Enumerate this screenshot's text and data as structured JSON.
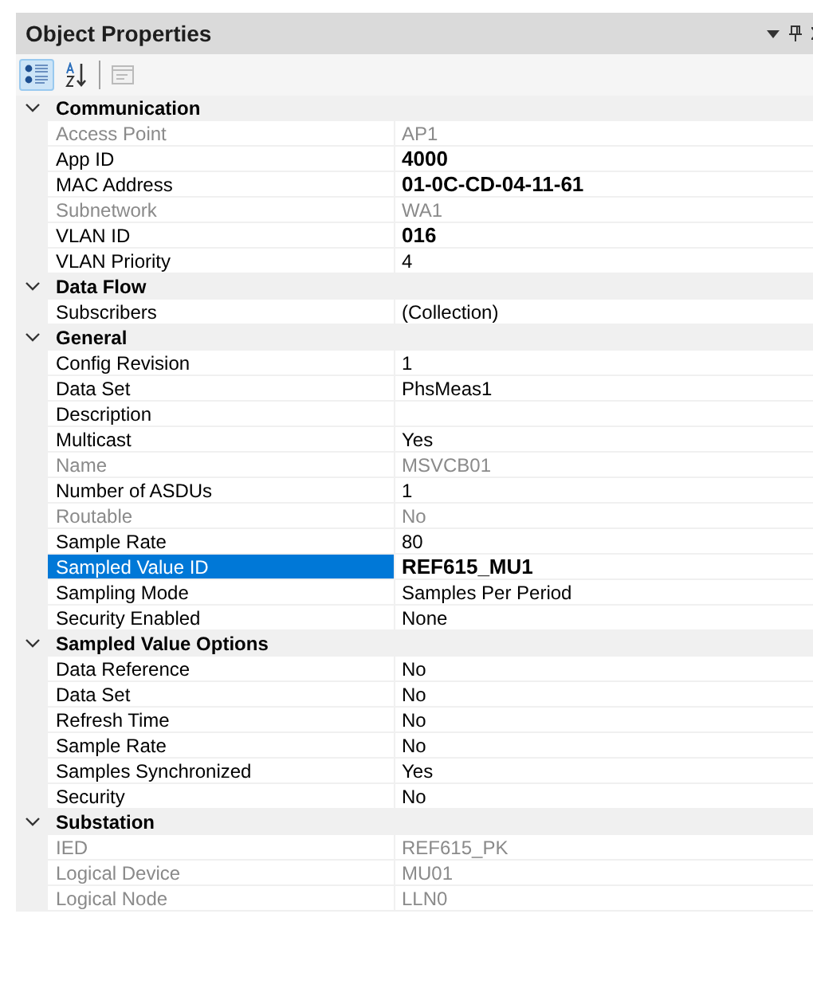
{
  "panel": {
    "title": "Object Properties"
  },
  "toolbar": [
    {
      "kind": "categorized",
      "selected": true,
      "disabled": false
    },
    {
      "kind": "alphabetical",
      "selected": false,
      "disabled": false
    },
    {
      "kind": "pages",
      "selected": false,
      "disabled": true
    }
  ],
  "categories": [
    {
      "name": "Communication",
      "expanded": true,
      "properties": [
        {
          "name": "Access Point",
          "value": "AP1",
          "disabled": true,
          "bold": false,
          "selected": false
        },
        {
          "name": "App ID",
          "value": "4000",
          "disabled": false,
          "bold": true,
          "selected": false
        },
        {
          "name": "MAC Address",
          "value": "01-0C-CD-04-11-61",
          "disabled": false,
          "bold": true,
          "selected": false
        },
        {
          "name": "Subnetwork",
          "value": "WA1",
          "disabled": true,
          "bold": false,
          "selected": false
        },
        {
          "name": "VLAN ID",
          "value": "016",
          "disabled": false,
          "bold": true,
          "selected": false
        },
        {
          "name": "VLAN Priority",
          "value": "4",
          "disabled": false,
          "bold": false,
          "selected": false
        }
      ]
    },
    {
      "name": "Data Flow",
      "expanded": true,
      "properties": [
        {
          "name": "Subscribers",
          "value": "(Collection)",
          "disabled": false,
          "bold": false,
          "selected": false
        }
      ]
    },
    {
      "name": "General",
      "expanded": true,
      "properties": [
        {
          "name": "Config Revision",
          "value": "1",
          "disabled": false,
          "bold": false,
          "selected": false
        },
        {
          "name": "Data Set",
          "value": "PhsMeas1",
          "disabled": false,
          "bold": false,
          "selected": false
        },
        {
          "name": "Description",
          "disabled": false,
          "bold": false,
          "selected": false
        },
        {
          "name": "Multicast",
          "value": "Yes",
          "disabled": false,
          "bold": false,
          "selected": false
        },
        {
          "name": "Name",
          "value": "MSVCB01",
          "disabled": true,
          "bold": false,
          "selected": false
        },
        {
          "name": "Number of ASDUs",
          "value": "1",
          "disabled": false,
          "bold": false,
          "selected": false
        },
        {
          "name": "Routable",
          "value": "No",
          "disabled": true,
          "bold": false,
          "selected": false
        },
        {
          "name": "Sample Rate",
          "value": "80",
          "disabled": false,
          "bold": false,
          "selected": false
        },
        {
          "name": "Sampled Value ID",
          "value": "REF615_MU1",
          "disabled": false,
          "bold": true,
          "selected": true
        },
        {
          "name": "Sampling Mode",
          "value": "Samples Per Period",
          "disabled": false,
          "bold": false,
          "selected": false
        },
        {
          "name": "Security Enabled",
          "value": "None",
          "disabled": false,
          "bold": false,
          "selected": false
        }
      ]
    },
    {
      "name": "Sampled Value Options",
      "expanded": true,
      "properties": [
        {
          "name": "Data Reference",
          "value": "No",
          "disabled": false,
          "bold": false,
          "selected": false
        },
        {
          "name": "Data Set",
          "value": "No",
          "disabled": false,
          "bold": false,
          "selected": false
        },
        {
          "name": "Refresh Time",
          "value": "No",
          "disabled": false,
          "bold": false,
          "selected": false
        },
        {
          "name": "Sample Rate",
          "value": "No",
          "disabled": false,
          "bold": false,
          "selected": false
        },
        {
          "name": "Samples Synchronized",
          "value": "Yes",
          "disabled": false,
          "bold": false,
          "selected": false
        },
        {
          "name": "Security",
          "value": "No",
          "disabled": false,
          "bold": false,
          "selected": false
        }
      ]
    },
    {
      "name": "Substation",
      "expanded": true,
      "properties": [
        {
          "name": "IED",
          "value": "REF615_PK",
          "disabled": true,
          "bold": false,
          "selected": false
        },
        {
          "name": "Logical Device",
          "value": "MU01",
          "disabled": true,
          "bold": false,
          "selected": false
        },
        {
          "name": "Logical Node",
          "value": "LLN0",
          "disabled": true,
          "bold": false,
          "selected": false
        }
      ]
    }
  ]
}
